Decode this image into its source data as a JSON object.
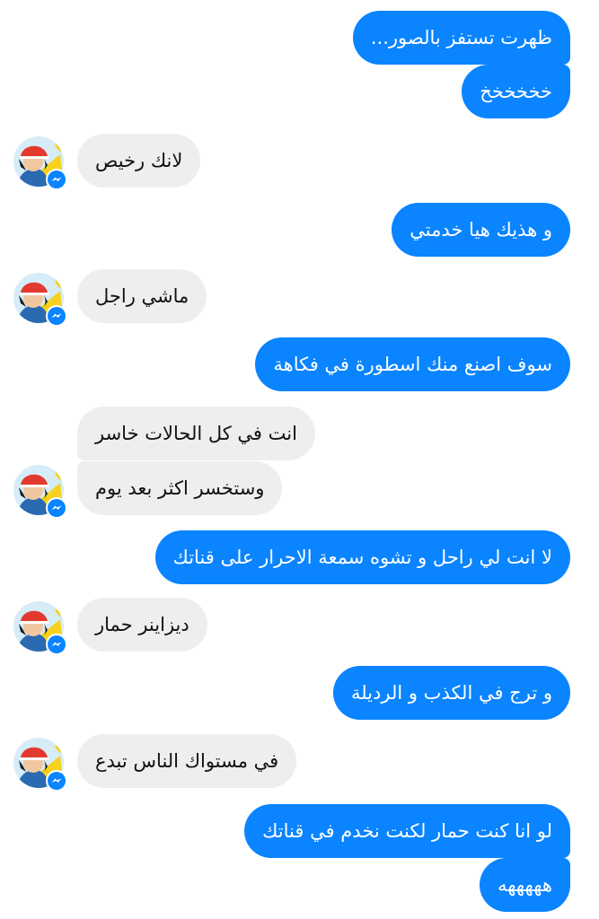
{
  "conversation": {
    "messages": [
      {
        "from": "me",
        "text": "ظهرت تستفز بالصور..."
      },
      {
        "from": "me",
        "text": "خخخخخخ"
      },
      {
        "from": "contact",
        "text": "لانك رخيص"
      },
      {
        "from": "me",
        "text": "و هذيك هيا خدمتي"
      },
      {
        "from": "contact",
        "text": "ماشي راجل"
      },
      {
        "from": "me",
        "text": "سوف اصنع منك اسطورة في فكاهة"
      },
      {
        "from": "contact",
        "text": "انت في كل الحالات خاسر"
      },
      {
        "from": "contact",
        "text": "وستخسر اكثر بعد يوم"
      },
      {
        "from": "me",
        "text": "لا انت لي راحل و تشوه سمعة الاحرار على قناتك"
      },
      {
        "from": "contact",
        "text": "ديزاينر حمار"
      },
      {
        "from": "me",
        "text": "و ترج في الكذب و الرديلة"
      },
      {
        "from": "contact",
        "text": "في مستواك الناس تبدع"
      },
      {
        "from": "me",
        "text": "لو انا كنت حمار لكنت نخدم في قناتك"
      },
      {
        "from": "me",
        "text": "هههههه"
      }
    ]
  },
  "colors": {
    "sent_bubble": "#0a84ff",
    "received_bubble": "#eeedf0",
    "messenger_badge": "#0a84ff"
  },
  "icons": {
    "avatar": "contact-avatar",
    "badge": "messenger-icon"
  }
}
